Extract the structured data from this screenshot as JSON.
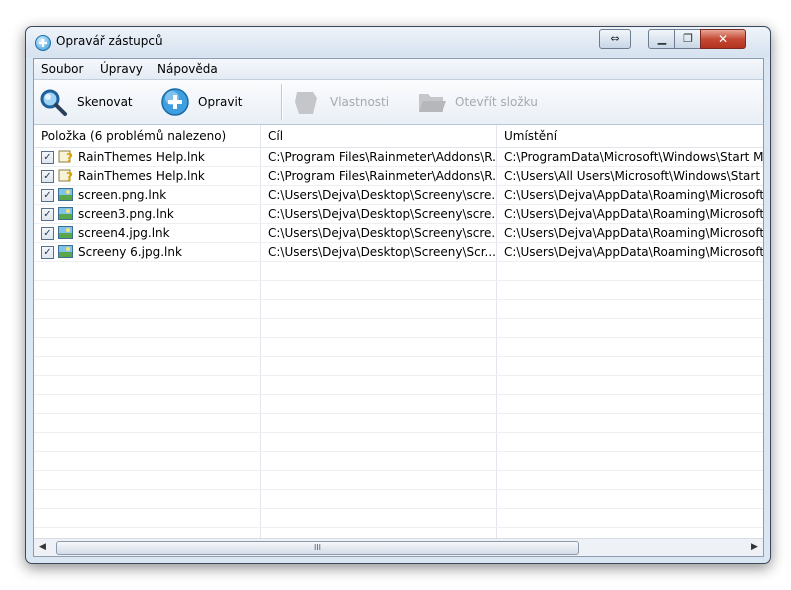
{
  "window": {
    "title": "Opravář zástupců"
  },
  "menu": [
    "Soubor",
    "Úpravy",
    "Nápověda"
  ],
  "toolbar": {
    "scan_label": "Skenovat",
    "fix_label": "Opravit",
    "properties_label": "Vlastnosti",
    "open_folder_label": "Otevřít složku"
  },
  "list": {
    "headers": [
      "Položka (6 problémů nalezeno)",
      "Cíl",
      "Umístění"
    ],
    "rows": [
      {
        "checked": true,
        "icon": "question-icon",
        "name": "RainThemes Help.lnk",
        "target": "C:\\Program Files\\Rainmeter\\Addons\\R...",
        "location": "C:\\ProgramData\\Microsoft\\Windows\\Start Menu"
      },
      {
        "checked": true,
        "icon": "question-icon",
        "name": "RainThemes Help.lnk",
        "target": "C:\\Program Files\\Rainmeter\\Addons\\R...",
        "location": "C:\\Users\\All Users\\Microsoft\\Windows\\Start Me"
      },
      {
        "checked": true,
        "icon": "image-icon",
        "name": "screen.png.lnk",
        "target": "C:\\Users\\Dejva\\Desktop\\Screeny\\scre...",
        "location": "C:\\Users\\Dejva\\AppData\\Roaming\\Microsoft\\W"
      },
      {
        "checked": true,
        "icon": "image-icon",
        "name": "screen3.png.lnk",
        "target": "C:\\Users\\Dejva\\Desktop\\Screeny\\scre...",
        "location": "C:\\Users\\Dejva\\AppData\\Roaming\\Microsoft\\W"
      },
      {
        "checked": true,
        "icon": "image-icon",
        "name": "screen4.jpg.lnk",
        "target": "C:\\Users\\Dejva\\Desktop\\Screeny\\scre...",
        "location": "C:\\Users\\Dejva\\AppData\\Roaming\\Microsoft\\W"
      },
      {
        "checked": true,
        "icon": "image-icon",
        "name": "Screeny 6.jpg.lnk",
        "target": "C:\\Users\\Dejva\\Desktop\\Screeny\\Scr...",
        "location": "C:\\Users\\Dejva\\AppData\\Roaming\\Microsoft\\W"
      }
    ]
  },
  "scrollbar": {
    "grip": "III"
  }
}
